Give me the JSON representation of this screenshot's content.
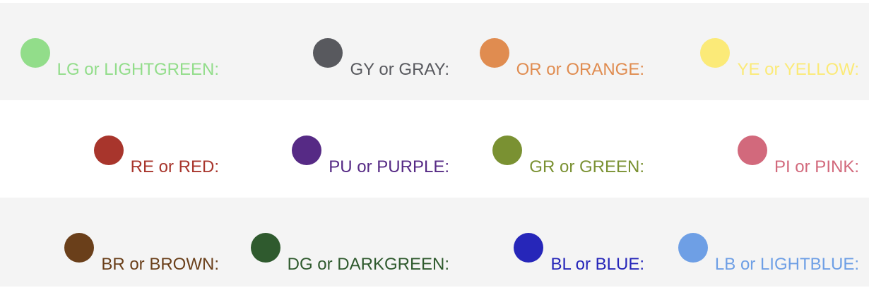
{
  "legend": {
    "rows": [
      [
        {
          "label": "LG or LIGHTGREEN:",
          "color": "#92dd8a"
        },
        {
          "label": "GY or GRAY:",
          "color": "#58595e"
        },
        {
          "label": "OR or ORANGE:",
          "color": "#e08c50"
        },
        {
          "label": "YE or YELLOW:",
          "color": "#fbea78"
        }
      ],
      [
        {
          "label": "RE or RED:",
          "color": "#a8352c"
        },
        {
          "label": "PU or PURPLE:",
          "color": "#562a85"
        },
        {
          "label": "GR or GREEN:",
          "color": "#7a9132"
        },
        {
          "label": "PI or PINK:",
          "color": "#d2697c"
        }
      ],
      [
        {
          "label": "BR or BROWN:",
          "color": "#6a3f1a"
        },
        {
          "label": "DG or DARKGREEN:",
          "color": "#2f5a2e"
        },
        {
          "label": "BL or BLUE:",
          "color": "#2626b9"
        },
        {
          "label": "LB or LIGHTBLUE:",
          "color": "#6e9fe5"
        }
      ]
    ]
  }
}
